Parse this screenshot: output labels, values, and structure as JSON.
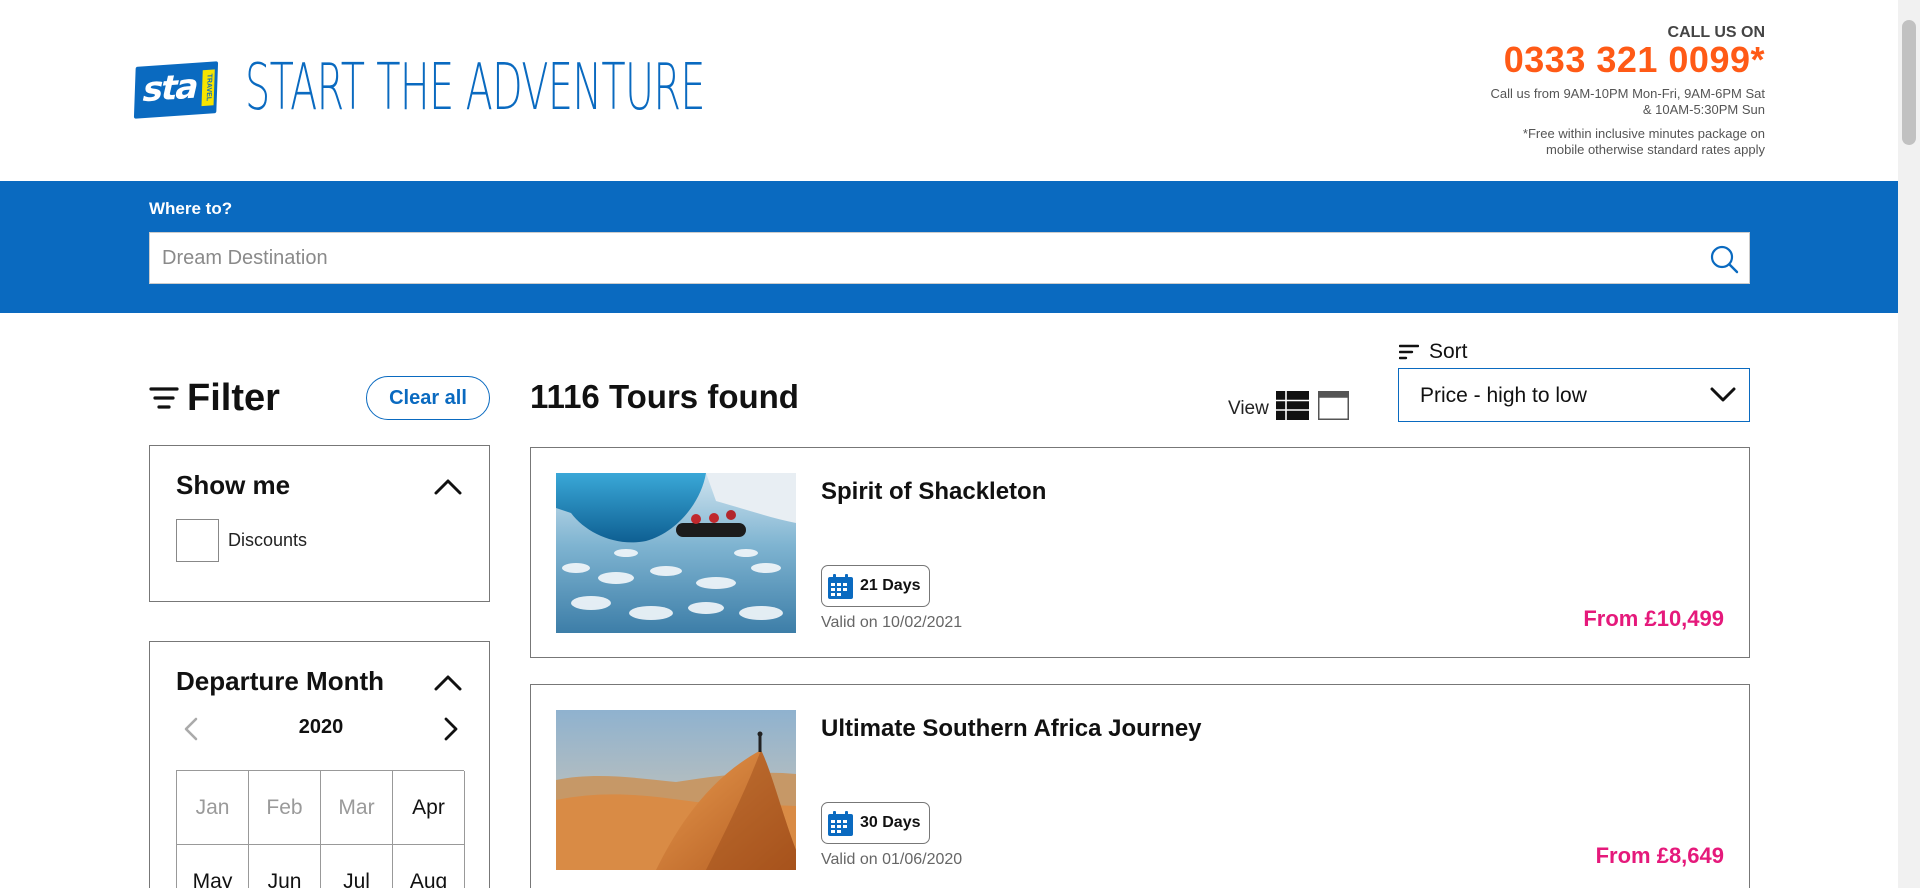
{
  "header": {
    "logo_text": "sta",
    "logo_sub": "TRAVEL",
    "tagline": "START THE ADVENTURE",
    "call_title": "CALL US ON",
    "call_number": "0333 321 0099*",
    "call_hours_line1": "Call us from 9AM-10PM Mon-Fri, 9AM-6PM Sat",
    "call_hours_line2": "& 10AM-5:30PM Sun",
    "call_note_line1": "*Free within inclusive minutes package on",
    "call_note_line2": "mobile otherwise standard rates apply"
  },
  "search": {
    "label": "Where to?",
    "placeholder": "Dream Destination",
    "value": ""
  },
  "filter": {
    "title": "Filter",
    "clear_label": "Clear all",
    "show_me": {
      "title": "Show me",
      "options": [
        "Discounts"
      ]
    },
    "departure_month": {
      "title": "Departure Month",
      "year": "2020",
      "months": [
        "Jan",
        "Feb",
        "Mar",
        "Apr",
        "May",
        "Jun",
        "Jul",
        "Aug"
      ]
    }
  },
  "results": {
    "count_label": "1116 Tours found",
    "view_label": "View",
    "sort_label": "Sort",
    "sort_value": "Price - high to low"
  },
  "tours": [
    {
      "title": "Spirit of Shackleton",
      "days": "21 Days",
      "valid": "Valid on 10/02/2021",
      "price": "From £10,499"
    },
    {
      "title": "Ultimate Southern Africa Journey",
      "days": "30 Days",
      "valid": "Valid on 01/06/2020",
      "price": "From £8,649"
    }
  ],
  "colors": {
    "brand_blue": "#0a6ac0",
    "phone_orange": "#ff5a16",
    "price_pink": "#e5197b"
  }
}
